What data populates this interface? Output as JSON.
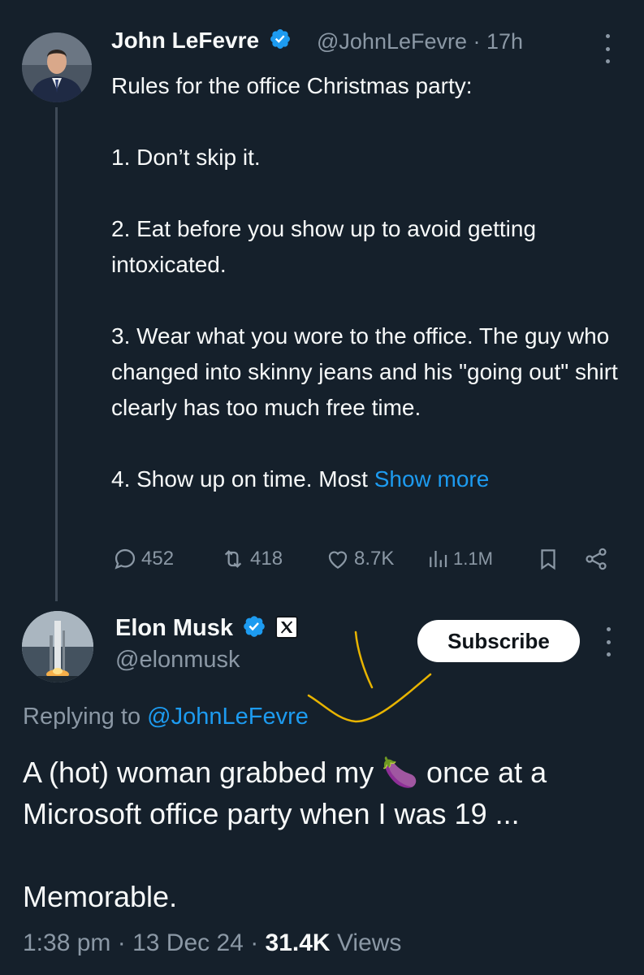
{
  "parent": {
    "name": "John LeFevre",
    "handle": "@JohnLeFevre",
    "time": "· 17h",
    "body": "Rules for the office Christmas party:\n\n1. Don’t skip it.\n\n2. Eat before you show up to avoid getting intoxicated.\n\n3. Wear what you wore to the office. The guy who changed into skinny jeans and his \"going out\" shirt clearly has too much free time.\n\n4. Show up on time. Most ",
    "show_more": "Show more",
    "stats": {
      "replies": "452",
      "reposts": "418",
      "likes": "8.7K",
      "views": "1.1M"
    }
  },
  "reply": {
    "name": "Elon Musk",
    "handle": "@elonmusk",
    "subscribe_label": "Subscribe",
    "replying_prefix": "Replying to ",
    "replying_handle": "@JohnLeFevre",
    "text_before_emoji": "A (hot) woman grabbed my ",
    "emoji": "🍆",
    "text_after_emoji": " once at a Microsoft office party when I was 19 ...\n\nMemorable.",
    "time": "1:38 pm",
    "date": "13 Dec 24",
    "views_count": "31.4K",
    "views_label": "Views"
  },
  "colors": {
    "background": "#15202b",
    "text": "#f7f9f9",
    "muted": "#8b98a5",
    "accent": "#1d9bf0",
    "annotation": "#e8b400"
  },
  "icons": [
    "verified-badge-icon",
    "more-icon",
    "reply-icon",
    "repost-icon",
    "like-icon",
    "views-icon",
    "bookmark-icon",
    "share-icon",
    "x-logo-icon"
  ]
}
